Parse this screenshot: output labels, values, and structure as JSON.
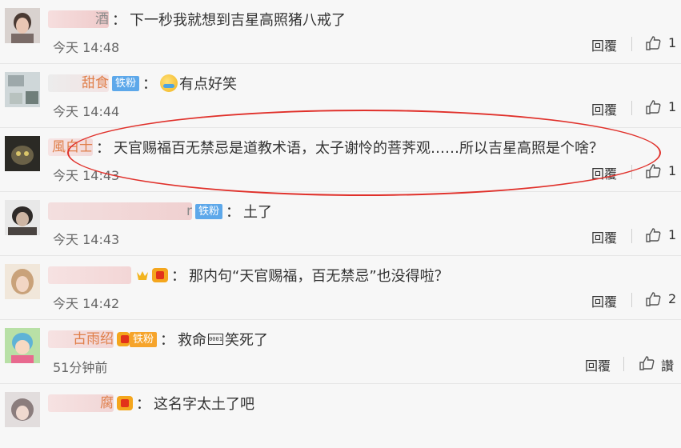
{
  "colors": {
    "oval": "#e0312b",
    "badge_blue": "#5da8ea",
    "badge_orange": "#f6a42b"
  },
  "actions": {
    "reply_label": "回覆"
  },
  "comments": [
    {
      "nick_tail": "酒",
      "text": "下一秒我就想到吉星高照猪八戒了",
      "time": "今天 14:48",
      "likes": "1"
    },
    {
      "nick_tail": "甜食",
      "badge": "铁粉",
      "emoji": "laughing-crying",
      "text": "有点好笑",
      "time": "今天 14:44",
      "likes": "1"
    },
    {
      "nick_tail": "風白士",
      "text": "天官赐福百无禁忌是道教术语，太子谢怜的菩荠观……所以吉星高照是个啥？",
      "time": "今天 14:43",
      "likes": "1"
    },
    {
      "nick_tail": "r",
      "badge": "铁粉",
      "text": "土了",
      "time": "今天 14:43",
      "likes": "1"
    },
    {
      "nick_tail": "",
      "text": "那内句“天官赐福，百无禁忌”也没得啦？",
      "time": "今天 14:42",
      "likes": "2"
    },
    {
      "nick_tail": "古雨绍",
      "badge": "铁粉",
      "text_a": "救命",
      "box_glyph": "0001",
      "text_b": " 笑死了",
      "time": "51分钟前",
      "likes": "讚"
    },
    {
      "nick_tail": "腐",
      "text": "这名字太土了吧"
    }
  ]
}
